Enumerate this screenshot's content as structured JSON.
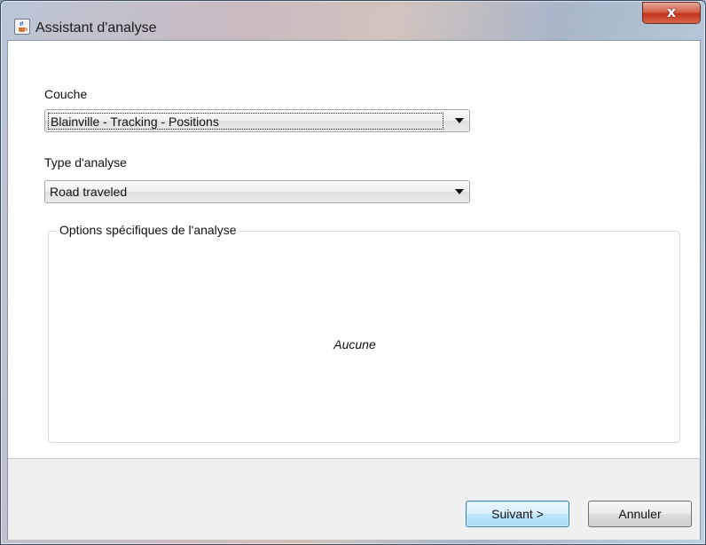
{
  "window": {
    "title": "Assistant d'analyse",
    "close_label": "x"
  },
  "form": {
    "layer_label": "Couche",
    "layer_value": "Blainville - Tracking - Positions",
    "analysis_type_label": "Type d'analyse",
    "analysis_type_value": "Road traveled",
    "options_group_label": "Options spécifiques de l'analyse",
    "options_empty_text": "Aucune"
  },
  "footer": {
    "next_label": "Suivant >",
    "cancel_label": "Annuler"
  },
  "icons": {
    "app": "java-cup-icon",
    "close": "close-icon",
    "dropdown": "chevron-down-icon"
  },
  "colors": {
    "close_button": "#c2331a",
    "primary_button_border": "#3c7fb1"
  }
}
